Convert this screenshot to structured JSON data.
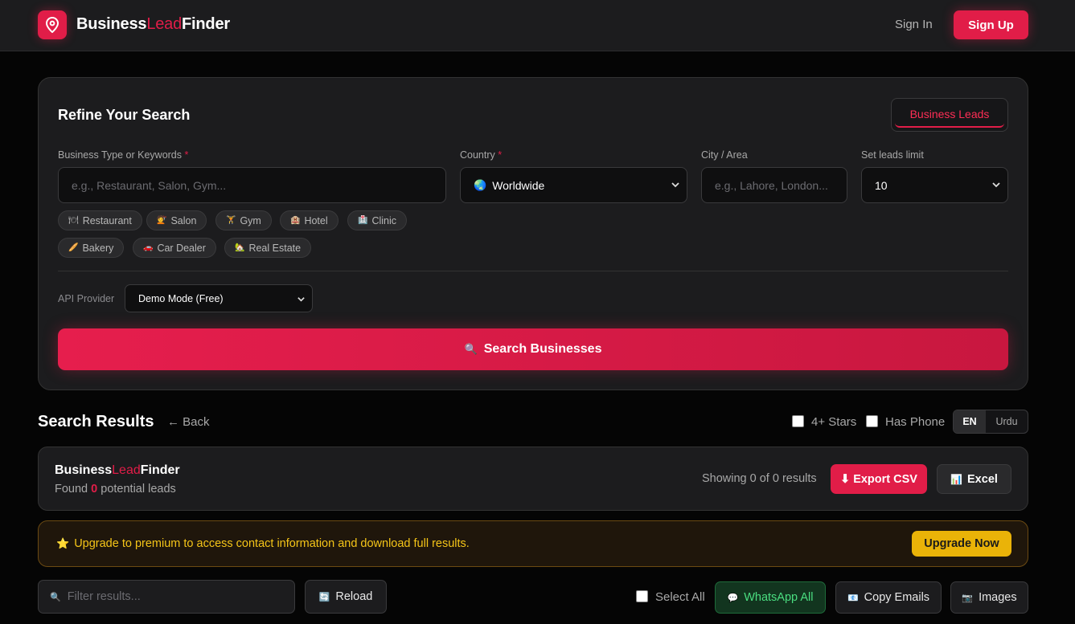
{
  "header": {
    "brand": {
      "part1": "Business",
      "part2": "Lead",
      "part3": "Finder"
    },
    "signin_label": "Sign In",
    "signup_label": "Sign Up"
  },
  "search_card": {
    "title": "Refine Your Search",
    "mode_tab": "Business Leads",
    "business_type": {
      "label": "Business Type or Keywords",
      "required": "*",
      "placeholder": "e.g., Restaurant, Salon, Gym..."
    },
    "country": {
      "label": "Country",
      "required": "*",
      "value": "Worldwide"
    },
    "city": {
      "label": "City / Area",
      "placeholder": "e.g., Lahore, London..."
    },
    "limit": {
      "label": "Set leads limit",
      "value": "10"
    },
    "chips": [
      {
        "emoji": "🍽",
        "label": "Restaurant"
      },
      {
        "emoji": "💇",
        "label": "Salon"
      },
      {
        "emoji": "🏋",
        "label": "Gym"
      },
      {
        "emoji": "🏨",
        "label": "Hotel"
      },
      {
        "emoji": "🏥",
        "label": "Clinic"
      },
      {
        "emoji": "🥖",
        "label": "Bakery"
      },
      {
        "emoji": "🚗",
        "label": "Car Dealer"
      },
      {
        "emoji": "🏡",
        "label": "Real Estate"
      }
    ],
    "api_provider": {
      "label": "API Provider",
      "value": "Demo Mode (Free)"
    },
    "search_button": "Search Businesses"
  },
  "results": {
    "title": "Search Results",
    "back_label": "← Back",
    "filter_stars": "4+ Stars",
    "filter_phone": "Has Phone",
    "lang_en": "EN",
    "lang_ur": "Urdu"
  },
  "summary": {
    "brand": {
      "part1": "Business",
      "part2": "Lead",
      "part3": "Finder"
    },
    "found_prefix": "Found",
    "found_count": "0",
    "found_suffix": "potential leads",
    "showing": "Showing 0 of 0 results",
    "export_label": "Export CSV",
    "excel_label": "Excel"
  },
  "banner": {
    "text": "Upgrade to premium to access contact information and download full results.",
    "button": "Upgrade Now"
  },
  "toolbar": {
    "filter_placeholder": "Filter results...",
    "reload": "Reload",
    "select_all": "Select All",
    "whatsapp": "WhatsApp All",
    "copy_emails": "Copy Emails",
    "images": "Images"
  },
  "colors": {
    "accent": "#e11d48",
    "warning": "#eab308",
    "success": "#4ade80",
    "bg": "#050505",
    "card": "#1c1c1e"
  }
}
